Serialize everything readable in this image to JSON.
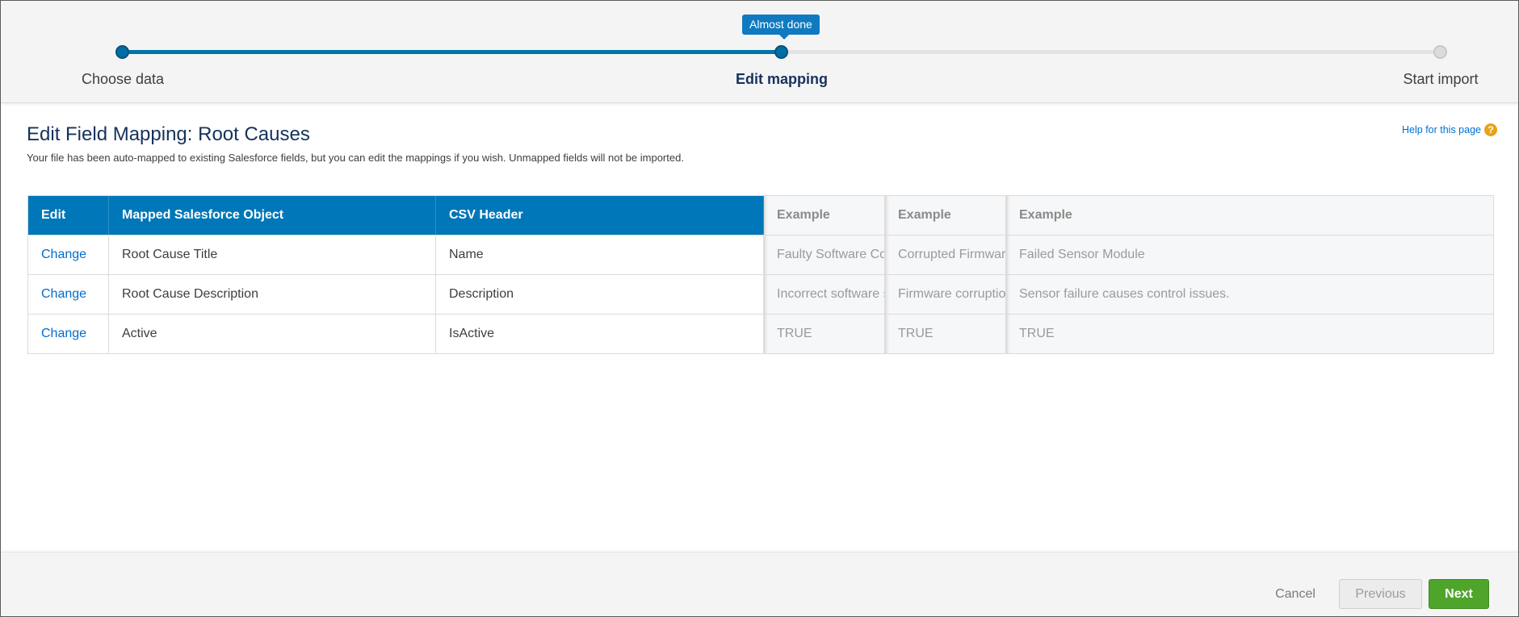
{
  "progress": {
    "tooltip": "Almost done",
    "steps": [
      {
        "label": "Choose data",
        "state": "done"
      },
      {
        "label": "Edit mapping",
        "state": "active"
      },
      {
        "label": "Start import",
        "state": "todo"
      }
    ],
    "colors": {
      "complete": "#0073a8",
      "incomplete": "#e3e3e3"
    }
  },
  "page": {
    "title": "Edit Field Mapping: Root Causes",
    "description": "Your file has been auto-mapped to existing Salesforce fields, but you can edit the mappings if you wish. Unmapped fields will not be imported.",
    "help_link": "Help for this page",
    "help_icon": "?"
  },
  "table": {
    "headers": [
      "Edit",
      "Mapped Salesforce Object",
      "CSV Header",
      "Example",
      "Example",
      "Example"
    ],
    "rows": [
      {
        "edit": "Change",
        "object": "Root Cause Title",
        "csv": "Name",
        "ex1": "Faulty Software Co",
        "ex2": "Corrupted Firmware",
        "ex3": "Failed Sensor Module"
      },
      {
        "edit": "Change",
        "object": "Root Cause Description",
        "csv": "Description",
        "ex1": "Incorrect software s",
        "ex2": "Firmware corruption",
        "ex3": "Sensor failure causes control issues."
      },
      {
        "edit": "Change",
        "object": "Active",
        "csv": "IsActive",
        "ex1": "TRUE",
        "ex2": "TRUE",
        "ex3": "TRUE"
      }
    ],
    "header_color": "#0077b8"
  },
  "footer": {
    "cancel": "Cancel",
    "previous": "Previous",
    "next": "Next",
    "next_color": "#4fa52b"
  }
}
